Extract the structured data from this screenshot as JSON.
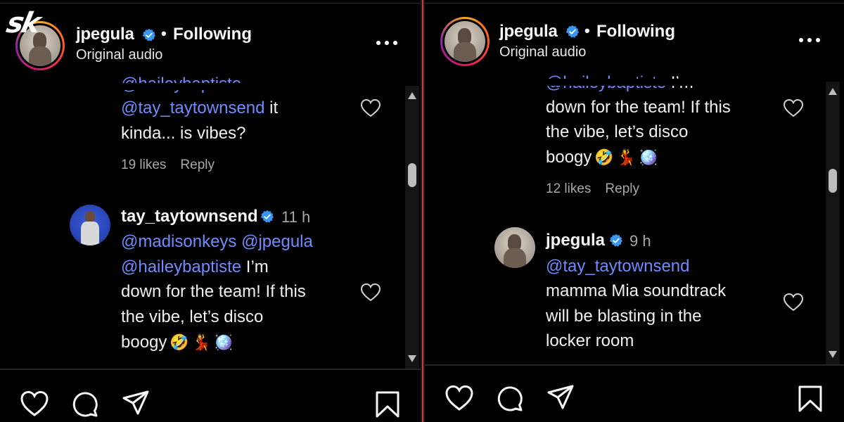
{
  "watermark": {
    "logo_text": "sk"
  },
  "left_panel": {
    "header": {
      "username": "jpegula",
      "separator": "•",
      "following": "Following",
      "audio": "Original audio"
    },
    "comment_top": {
      "lines": [
        {
          "mention": "@haileybaptiste",
          "text": ""
        },
        {
          "mention": "@tay_taytownsend",
          "text": " it"
        },
        {
          "mention": "",
          "text": "kinda... is vibes?"
        }
      ],
      "likes": "19 likes",
      "reply": "Reply"
    },
    "comment_main": {
      "username": "tay_taytownsend",
      "time": "11 h",
      "lines": [
        {
          "mention": "@madisonkeys @jpegula",
          "text": ""
        },
        {
          "mention": "@haileybaptiste",
          "text": " I’m"
        },
        {
          "mention": "",
          "text": "down for the team! If this"
        },
        {
          "mention": "",
          "text": "the vibe, let’s disco"
        },
        {
          "mention": "",
          "text": "boogy"
        }
      ],
      "emojis": [
        "🤣",
        "💃",
        "🪩"
      ]
    }
  },
  "right_panel": {
    "header": {
      "username": "jpegula",
      "separator": "•",
      "following": "Following",
      "audio": "Original audio"
    },
    "comment_top": {
      "lines": [
        {
          "mention": "@haileybaptiste",
          "text": " I’m"
        },
        {
          "mention": "",
          "text": "down for the team! If this"
        },
        {
          "mention": "",
          "text": "the vibe, let’s disco"
        },
        {
          "mention": "",
          "text": "boogy"
        }
      ],
      "emojis": [
        "🤣",
        "💃",
        "🪩"
      ],
      "likes": "12 likes",
      "reply": "Reply"
    },
    "comment_main": {
      "username": "jpegula",
      "time": "9 h",
      "lines": [
        {
          "mention": "@tay_taytownsend",
          "text": ""
        },
        {
          "mention": "",
          "text": "mamma Mia soundtrack"
        },
        {
          "mention": "",
          "text": "will be blasting in the"
        },
        {
          "mention": "",
          "text": "locker room"
        }
      ]
    }
  },
  "colors": {
    "background": "#000000",
    "mention": "#6f8cff",
    "verified": "#3897f0",
    "divider": "#d23a3a",
    "muted_text": "#a8a8a8"
  }
}
